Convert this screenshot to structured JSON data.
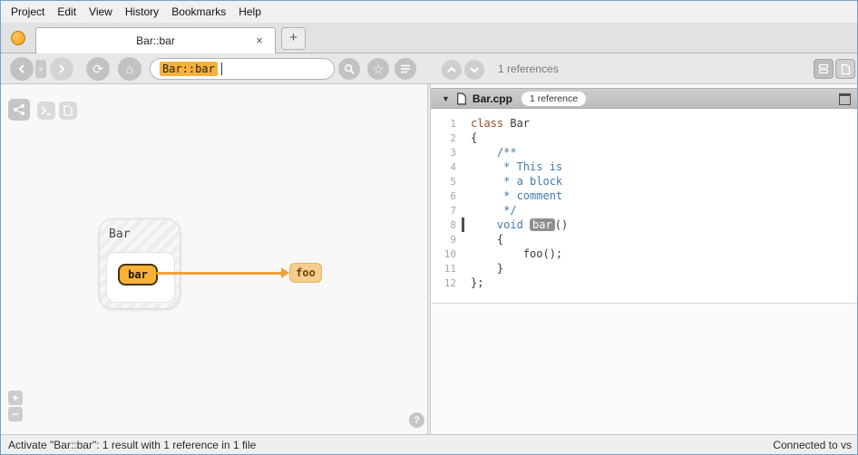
{
  "colors": {
    "accent": "#f7b13c",
    "node_orange": "#f9b235",
    "edge": "#efa23a",
    "comment_blue": "#3f7cad",
    "keyword_red": "#9e4a1e"
  },
  "menu": {
    "items": [
      "Project",
      "Edit",
      "View",
      "History",
      "Bookmarks",
      "Help"
    ]
  },
  "tabs": {
    "active_title": "Bar::bar",
    "close_glyph": "×",
    "new_tab_glyph": "+"
  },
  "toolbar": {
    "search_value": "Bar::bar",
    "icons": {
      "refresh": "⟳",
      "home": "⌂",
      "star": "☆",
      "history": "≡"
    }
  },
  "graph": {
    "class_label": "Bar",
    "member_label": "bar",
    "target_label": "foo",
    "zoom_in": "+",
    "zoom_out": "−",
    "help": "?"
  },
  "references": {
    "summary": "1 references"
  },
  "file": {
    "expand_glyph": "▼",
    "name": "Bar.cpp",
    "badge": "1 reference"
  },
  "code": {
    "lines": [
      {
        "no": "1",
        "tokens": [
          {
            "t": "class",
            "c": "kw"
          },
          {
            "t": " ",
            "c": "p"
          },
          {
            "t": "Bar",
            "c": "type"
          }
        ]
      },
      {
        "no": "2",
        "tokens": [
          {
            "t": "{",
            "c": "p"
          }
        ]
      },
      {
        "no": "3",
        "tokens": [
          {
            "t": "    ",
            "c": "p"
          },
          {
            "t": "/**",
            "c": "cm"
          }
        ]
      },
      {
        "no": "4",
        "tokens": [
          {
            "t": "     ",
            "c": "p"
          },
          {
            "t": "* This is",
            "c": "cm"
          }
        ]
      },
      {
        "no": "5",
        "tokens": [
          {
            "t": "     ",
            "c": "p"
          },
          {
            "t": "* a block",
            "c": "cm"
          }
        ]
      },
      {
        "no": "6",
        "tokens": [
          {
            "t": "     ",
            "c": "p"
          },
          {
            "t": "* comment",
            "c": "cm"
          }
        ]
      },
      {
        "no": "7",
        "tokens": [
          {
            "t": "     ",
            "c": "p"
          },
          {
            "t": "*/",
            "c": "cm"
          }
        ]
      },
      {
        "no": "8",
        "marker": true,
        "tokens": [
          {
            "t": "    ",
            "c": "p"
          },
          {
            "t": "void",
            "c": "kw2"
          },
          {
            "t": " ",
            "c": "p"
          },
          {
            "t": "bar",
            "c": "active"
          },
          {
            "t": "()",
            "c": "p"
          }
        ]
      },
      {
        "no": "9",
        "tokens": [
          {
            "t": "    {",
            "c": "p"
          }
        ]
      },
      {
        "no": "10",
        "tokens": [
          {
            "t": "        ",
            "c": "p"
          },
          {
            "t": "foo",
            "c": "fn"
          },
          {
            "t": "();",
            "c": "p"
          }
        ]
      },
      {
        "no": "11",
        "tokens": [
          {
            "t": "    }",
            "c": "p"
          }
        ]
      },
      {
        "no": "12",
        "tokens": [
          {
            "t": "};",
            "c": "p"
          }
        ]
      }
    ]
  },
  "statusbar": {
    "left": "Activate \"Bar::bar\": 1 result with 1 reference in 1 file",
    "right": "Connected to vs"
  }
}
